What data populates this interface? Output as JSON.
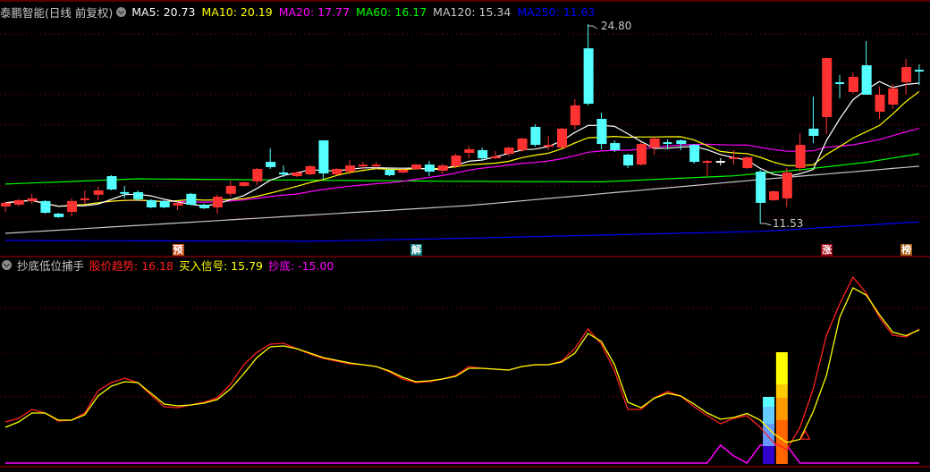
{
  "header": {
    "title": "泰鹏智能(日线 前复权)",
    "ma": [
      {
        "text": "MA5: 20.73",
        "color": "#ffffff"
      },
      {
        "text": "MA10: 20.19",
        "color": "#ffff00"
      },
      {
        "text": "MA20: 17.77",
        "color": "#ff00ff"
      },
      {
        "text": "MA60: 16.17",
        "color": "#00ff00"
      },
      {
        "text": "MA120: 15.34",
        "color": "#c8c8c8"
      },
      {
        "text": "MA250: 11.63",
        "color": "#0000ff"
      }
    ]
  },
  "price_chart": {
    "high_label": "24.80",
    "low_label": "11.53",
    "up_color": "#ff3232",
    "down_color": "#54ffff",
    "candles": [
      [
        12.66,
        12.9,
        12.96,
        12.3
      ],
      [
        12.78,
        13.08,
        13.14,
        12.66
      ],
      [
        13.02,
        13.2,
        13.5,
        12.84
      ],
      [
        13.02,
        12.24,
        13.08,
        12.18
      ],
      [
        12.18,
        11.95,
        12.24,
        11.89
      ],
      [
        12.3,
        13.02,
        13.2,
        12.01
      ],
      [
        13.08,
        13.14,
        13.73,
        12.84
      ],
      [
        13.44,
        13.73,
        13.97,
        13.08
      ],
      [
        14.68,
        13.79,
        14.74,
        13.73
      ],
      [
        13.56,
        13.56,
        14.03,
        13.2
      ],
      [
        13.61,
        13.14,
        13.73,
        13.02
      ],
      [
        13.08,
        12.6,
        13.14,
        12.54
      ],
      [
        13.02,
        12.6,
        13.08,
        12.54
      ],
      [
        12.72,
        12.9,
        12.96,
        12.42
      ],
      [
        13.5,
        12.78,
        13.56,
        12.72
      ],
      [
        12.78,
        12.54,
        12.84,
        12.48
      ],
      [
        12.6,
        13.31,
        13.44,
        12.18
      ],
      [
        13.5,
        14.03,
        14.39,
        13.31
      ],
      [
        14.03,
        14.27,
        14.33,
        13.97
      ],
      [
        14.33,
        15.16,
        15.22,
        14.09
      ],
      [
        15.63,
        15.28,
        16.53,
        15.16
      ],
      [
        14.86,
        14.86,
        15.39,
        14.62
      ],
      [
        14.68,
        14.92,
        14.98,
        14.62
      ],
      [
        14.8,
        15.34,
        15.39,
        14.74
      ],
      [
        17.06,
        14.86,
        17.06,
        14.45
      ],
      [
        14.8,
        15.16,
        15.22,
        14.74
      ],
      [
        14.98,
        15.39,
        15.76,
        14.8
      ],
      [
        15.39,
        15.39,
        15.63,
        15.1
      ],
      [
        15.39,
        15.39,
        15.63,
        15.16
      ],
      [
        15.1,
        14.74,
        15.16,
        14.68
      ],
      [
        14.92,
        15.1,
        15.16,
        14.86
      ],
      [
        15.16,
        15.45,
        15.51,
        15.1
      ],
      [
        15.45,
        14.98,
        15.69,
        14.68
      ],
      [
        15.04,
        15.39,
        15.51,
        14.8
      ],
      [
        15.34,
        16.05,
        16.17,
        15.22
      ],
      [
        16.23,
        16.47,
        16.7,
        15.87
      ],
      [
        16.41,
        15.87,
        16.58,
        15.69
      ],
      [
        15.87,
        15.99,
        16.35,
        15.81
      ],
      [
        16.17,
        16.58,
        16.64,
        15.99
      ],
      [
        16.41,
        17.18,
        17.24,
        16.29
      ],
      [
        17.96,
        16.76,
        18.13,
        16.64
      ],
      [
        16.64,
        16.76,
        17.36,
        16.41
      ],
      [
        16.58,
        17.84,
        17.9,
        16.53
      ],
      [
        18.07,
        19.39,
        19.8,
        17.78
      ],
      [
        23.19,
        19.5,
        24.8,
        19.39
      ],
      [
        18.49,
        16.82,
        18.91,
        16.47
      ],
      [
        16.88,
        16.41,
        17.06,
        16.29
      ],
      [
        16.11,
        15.39,
        16.17,
        15.22
      ],
      [
        15.45,
        16.82,
        16.94,
        15.39
      ],
      [
        16.58,
        17.18,
        17.3,
        16.11
      ],
      [
        16.88,
        16.88,
        17.12,
        16.47
      ],
      [
        17.06,
        16.82,
        17.12,
        16.41
      ],
      [
        16.76,
        15.63,
        16.82,
        15.51
      ],
      [
        15.63,
        15.63,
        15.76,
        14.68
      ],
      [
        15.63,
        15.63,
        15.87,
        15.39
      ],
      [
        15.81,
        15.87,
        16.41,
        15.45
      ],
      [
        15.22,
        15.93,
        15.99,
        15.16
      ],
      [
        14.98,
        12.9,
        15.1,
        11.53
      ],
      [
        13.08,
        13.67,
        13.73,
        13.02
      ],
      [
        13.2,
        14.92,
        15.22,
        12.6
      ],
      [
        15.22,
        16.76,
        17.54,
        14.98
      ],
      [
        17.84,
        17.36,
        19.98,
        16.88
      ],
      [
        18.61,
        22.54,
        22.54,
        17.48
      ],
      [
        20.87,
        20.87,
        21.41,
        19.86
      ],
      [
        20.28,
        21.29,
        21.58,
        20.16
      ],
      [
        22.06,
        20.1,
        23.67,
        20.1
      ],
      [
        18.97,
        20.1,
        20.63,
        18.49
      ],
      [
        19.44,
        20.52,
        20.81,
        19.15
      ],
      [
        20.93,
        21.94,
        22.48,
        20.1
      ],
      [
        21.7,
        21.7,
        22.12,
        20.75
      ]
    ],
    "neutral_cross_index": 54,
    "long_ma": {
      "ma60": [
        [
          0,
          14.15
        ],
        [
          10,
          14.5
        ],
        [
          35,
          14.33
        ],
        [
          45,
          14.3
        ],
        [
          55,
          14.7
        ],
        [
          60,
          15.1
        ],
        [
          65,
          15.6
        ],
        [
          69,
          16.17
        ]
      ],
      "ma120": [
        [
          0,
          10.87
        ],
        [
          35,
          12.72
        ],
        [
          57,
          14.45
        ],
        [
          69,
          15.34
        ]
      ],
      "ma250": [
        [
          0,
          10.4
        ],
        [
          23,
          10.34
        ],
        [
          35,
          10.55
        ],
        [
          57,
          11.0
        ],
        [
          69,
          11.63
        ]
      ]
    },
    "markers": [
      {
        "index": 13,
        "text": "预",
        "color": "#c4521c"
      },
      {
        "index": 31,
        "text": "解",
        "color": "#0a7f7f"
      },
      {
        "index": 62,
        "text": "涨",
        "color": "#a0000f"
      },
      {
        "index": 68,
        "text": "榜",
        "color": "#a85a12"
      }
    ]
  },
  "indicator": {
    "name": "抄底低位捕手",
    "labels": [
      {
        "text": "股价趋势: 16.18",
        "color": "#ff2020"
      },
      {
        "text": "买入信号: 15.79",
        "color": "#ffff00"
      },
      {
        "text": "抄底: -15.00",
        "color": "#ff00ff"
      }
    ],
    "trend": [
      -25.42,
      -23.82,
      -19.82,
      -21.42,
      -25.02,
      -24.62,
      -21.42,
      -11.42,
      -7.82,
      -5.82,
      -7.82,
      -13.42,
      -18.62,
      -19.02,
      -17.82,
      -16.62,
      -14.62,
      -8.62,
      0.18,
      5.78,
      9.38,
      9.78,
      7.38,
      4.98,
      2.98,
      1.78,
      0.58,
      0.18,
      -0.62,
      -3.02,
      -6.22,
      -7.82,
      -7.42,
      -6.22,
      -4.62,
      -0.62,
      -1.42,
      -1.82,
      -2.22,
      -0.62,
      0.18,
      0.18,
      1.78,
      7.38,
      16.18,
      9.38,
      -2.62,
      -19.82,
      -19.82,
      -14.62,
      -11.82,
      -13.82,
      -18.62,
      -22.62,
      -26.22,
      -23.82,
      -22.62,
      -27.82,
      -34.62,
      -37.82,
      -27.82,
      -10.62,
      13.38,
      27.38,
      39.38,
      32.18,
      21.38,
      13.38,
      12.58,
      16.18
    ],
    "signal": [
      -27.82,
      -25.42,
      -21.42,
      -21.42,
      -24.62,
      -24.62,
      -22.22,
      -13.82,
      -9.42,
      -7.42,
      -7.82,
      -12.62,
      -17.42,
      -18.22,
      -17.82,
      -17.02,
      -15.42,
      -10.62,
      -3.82,
      3.38,
      8.18,
      8.58,
      7.38,
      5.38,
      3.38,
      2.18,
      0.98,
      0.18,
      -0.62,
      -2.62,
      -5.42,
      -7.42,
      -7.02,
      -6.22,
      -5.02,
      -1.42,
      -1.42,
      -1.82,
      -2.22,
      -0.62,
      0.18,
      0.18,
      1.38,
      5.38,
      14.18,
      10.58,
      0.18,
      -16.62,
      -19.02,
      -14.82,
      -12.62,
      -13.82,
      -17.42,
      -21.42,
      -24.22,
      -23.42,
      -21.62,
      -24.62,
      -30.62,
      -34.62,
      -33.22,
      -20.82,
      -4.62,
      21.38,
      34.58,
      31.38,
      22.58,
      14.78,
      13.18,
      15.78
    ],
    "bottom": [
      -15,
      -15,
      -15,
      -15,
      -15,
      -15,
      -15,
      -15,
      -15,
      -15,
      -15,
      -15,
      -15,
      -15,
      -15,
      -15,
      -15,
      -15,
      -15,
      -15,
      -15,
      -15,
      -15,
      -15,
      -15,
      -15,
      -15,
      -15,
      -15,
      -15,
      -15,
      -15,
      -15,
      -15,
      -15,
      -15,
      -15,
      -15,
      -15,
      -15,
      -15,
      -15,
      -15,
      -15,
      -15,
      -15,
      -15,
      -15,
      -15,
      -15,
      -15,
      -15,
      -15,
      -15,
      0,
      -9,
      -15,
      0,
      0,
      0,
      -15,
      -15,
      -15,
      -15,
      -15,
      -15,
      -15,
      -15,
      -15,
      -15
    ],
    "columns": [
      {
        "index": 57.6,
        "segments": [
          [
            -14.22,
            -18.62,
            "#5cffff"
          ],
          [
            -18.62,
            -26.22,
            "#66ccff"
          ],
          [
            -26.22,
            -36.22,
            "#6699ff"
          ],
          [
            -36.22,
            -44.22,
            "#3300cc"
          ]
        ]
      },
      {
        "index": 58.6,
        "segments": [
          [
            5.78,
            -8.62,
            "#ffff00"
          ],
          [
            -8.62,
            -14.62,
            "#ffcc00"
          ],
          [
            -14.62,
            -24.62,
            "#ff9900"
          ],
          [
            -24.62,
            -44.22,
            "#ff6600"
          ]
        ]
      }
    ],
    "triangle_index": 60.4,
    "triangle_value": -31.5
  }
}
